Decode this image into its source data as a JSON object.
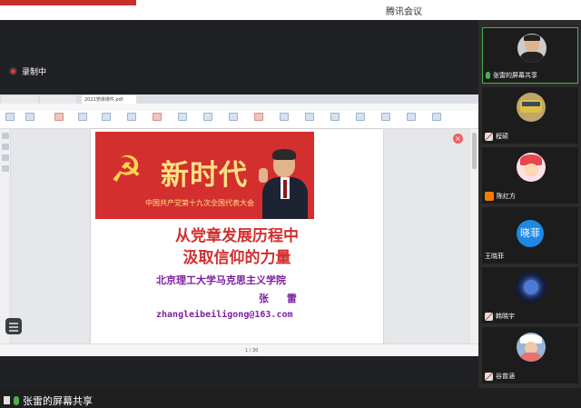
{
  "window": {
    "title": "腾讯会议"
  },
  "recording": {
    "label": "录制中"
  },
  "shared_screen": {
    "browser_tabs": [
      "",
      "2021党课课件.pdf",
      ""
    ],
    "slide": {
      "banner_title": "新时代",
      "banner_subtitle": "中国共产党第十九次全国代表大会",
      "title_line1": "从党章发展历程中",
      "title_line2": "汲取信仰的力量",
      "institution": "北京理工大学马克思主义学院",
      "presenter": "张  雷",
      "email": "zhangleibeiligong@163.com"
    },
    "page_indicator": "1 / 30"
  },
  "share_indicator": {
    "label": "张雷的屏幕共享"
  },
  "participants": [
    {
      "name": "张雷的屏幕共享",
      "mic": "on",
      "avatar": "photo-man"
    },
    {
      "name": "程硕",
      "mic": "off",
      "avatar": "bus"
    },
    {
      "name": "陈红方",
      "mic": "off",
      "avatar": "cartoon-girl"
    },
    {
      "name": "王晓菲",
      "mic": "none",
      "avatar": "text",
      "avatar_text": "晓菲"
    },
    {
      "name": "韩晓宇",
      "mic": "off",
      "avatar": "nebula"
    },
    {
      "name": "谷曾涵",
      "mic": "off",
      "avatar": "photo-girl"
    }
  ],
  "colors": {
    "accent_green": "#4caf50",
    "record_red": "#e53935",
    "slide_red": "#d32f2f",
    "slide_purple": "#7b1fa2"
  }
}
